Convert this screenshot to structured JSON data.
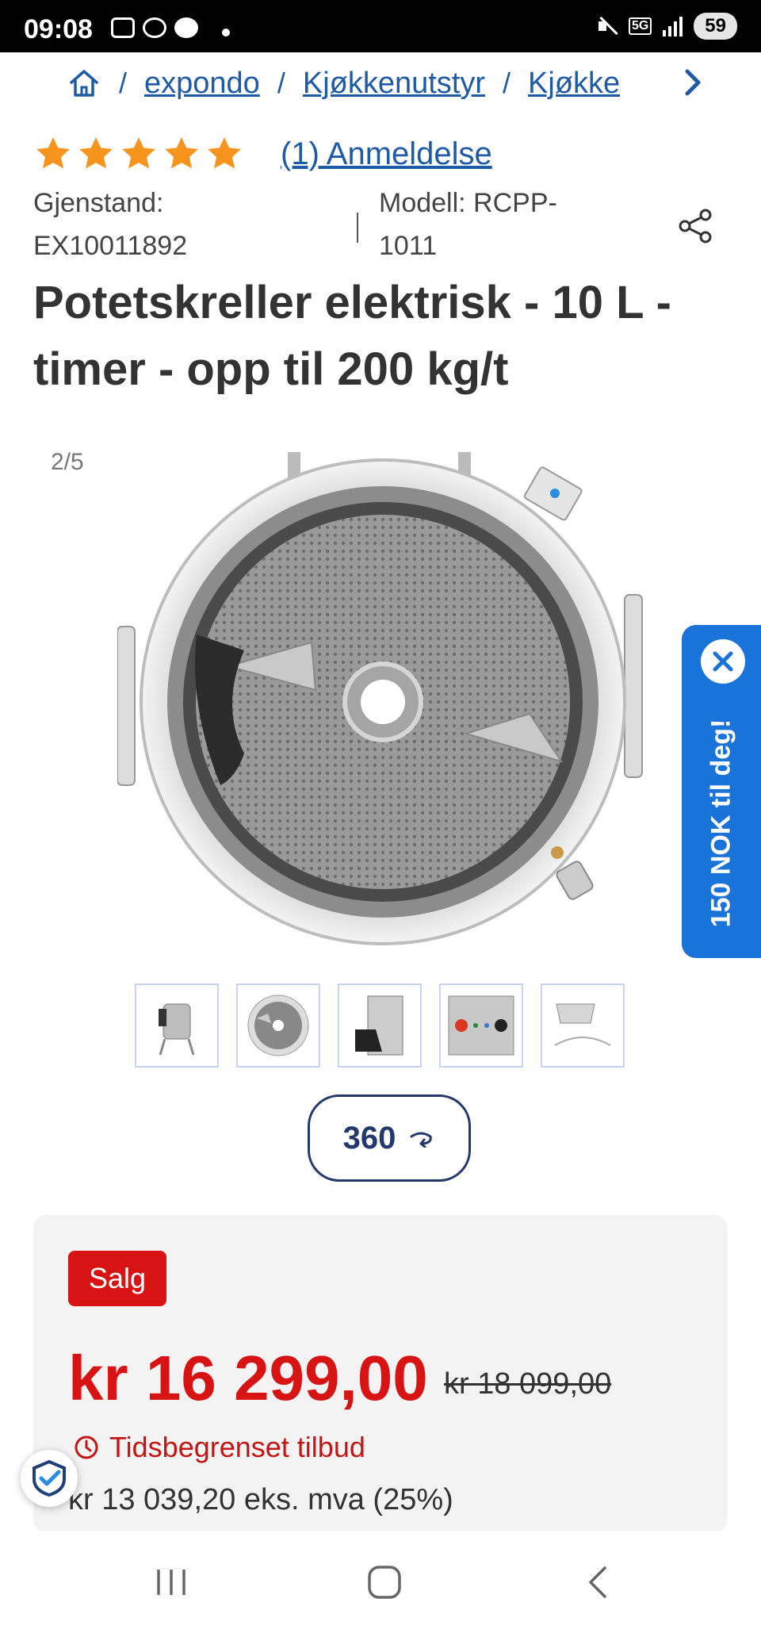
{
  "status_bar": {
    "time": "09:08",
    "network": "5G",
    "battery": "59",
    "icons": [
      "screenshot-icon",
      "whatsapp-icon",
      "messages-icon",
      "mute-icon",
      "signal-icon"
    ]
  },
  "breadcrumb": {
    "items": [
      "expondo",
      "Kjøkkenutstyr",
      "Kjøkke"
    ],
    "separator": "/"
  },
  "rating": {
    "stars": 5,
    "star_color": "#f7941d",
    "review_link": "(1) Anmeldelse"
  },
  "meta": {
    "item_label": "Gjenstand:",
    "item_number": "EX10011892",
    "model_label": "Modell: RCPP-",
    "model_number": "1011"
  },
  "product": {
    "title": "Potetskreller elektrisk - 10 L - timer - opp til 200 kg/t"
  },
  "gallery": {
    "counter": "2/5",
    "thumbnails": [
      "peeler-front",
      "peeler-top",
      "peeler-side",
      "control-panel",
      "tray-and-hose"
    ],
    "button_360": "360"
  },
  "promo": {
    "label": "150 NOK til deg!",
    "color": "#1a73d9"
  },
  "pricing": {
    "badge": "Salg",
    "price": "kr 16 299,00",
    "old_price": "kr 18 099,00",
    "limited_offer": "Tidsbegrenset tilbud",
    "ex_vat": "kr 13 039,20 eks. mva (25%)",
    "sale_color": "#d81313"
  },
  "colors": {
    "link": "#1f5aa6",
    "dark_navy": "#23396b"
  }
}
